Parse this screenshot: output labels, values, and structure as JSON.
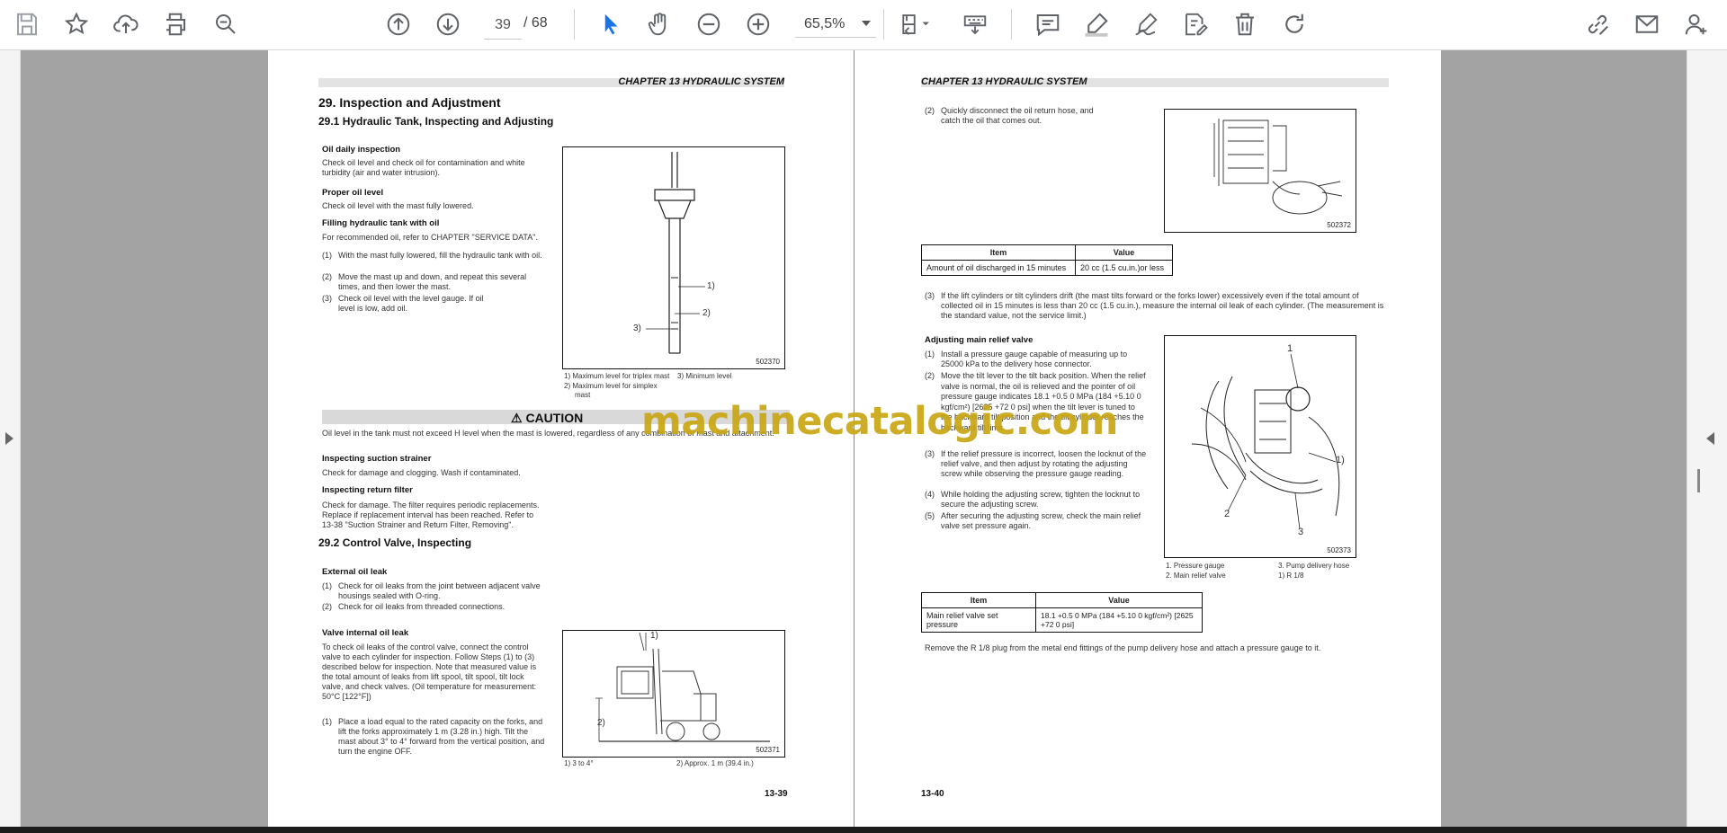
{
  "toolbar": {
    "page_current": "39",
    "page_total": "/ 68",
    "zoom": "65,5%",
    "icons": [
      "save-icon",
      "star-icon",
      "upload-icon",
      "print-icon",
      "zoom-search-icon",
      "page-up-icon",
      "page-down-icon",
      "select-arrow-icon",
      "hand-icon",
      "zoom-out-icon",
      "zoom-in-icon",
      "fit-page-icon",
      "keyboard-icon",
      "comment-icon",
      "highlight-pen-icon",
      "sign-pen-icon",
      "edit-doc-icon",
      "trash-icon",
      "redo-icon",
      "share-link-icon",
      "mail-icon",
      "add-user-icon"
    ]
  },
  "left_page": {
    "chapter": "CHAPTER 13 HYDRAULIC SYSTEM",
    "title": "29.  Inspection and Adjustment",
    "section1": "29.1    Hydraulic Tank, Inspecting and Adjusting",
    "oil_daily_heading": "Oil daily inspection",
    "oil_daily_text": "Check oil level and check oil for contamination and white turbidity (air and water intrusion).",
    "proper_heading": "Proper oil level",
    "proper_text": "Check oil level with the mast fully lowered.",
    "filling_heading": "Filling hydraulic tank with oil",
    "filling_text": "For recommended oil, refer to CHAPTER \"SERVICE DATA\".",
    "fill_steps": [
      {
        "n": "(1)",
        "text": "With the mast fully lowered, fill the hydraulic tank with oil."
      },
      {
        "n": "(2)",
        "text": "Move the mast up and down, and repeat this several times, and then lower the mast."
      },
      {
        "n": "(3)",
        "text": "Check oil level with the level gauge. If oil level is low, add oil."
      }
    ],
    "fig1_labels": [
      "1)",
      "2)",
      "3)"
    ],
    "fig1_no": "502370",
    "fig1_caption_a": "1) Maximum level for triplex mast",
    "fig1_caption_b": "3) Minimum level",
    "fig1_caption_c": "2) Maximum level for simplex",
    "fig1_caption_d": "mast",
    "caution_title": "⚠ CAUTION",
    "caution_text": "Oil level in the tank must not exceed H level when the mast is lowered, regardless of any combination of mast and attachment.",
    "suction_heading": "Inspecting suction strainer",
    "suction_text": "Check for damage and clogging. Wash if contaminated.",
    "return_heading": "Inspecting return filter",
    "return_text": "Check for damage. The filter requires periodic replacements. Replace if replacement interval has been reached. Refer to 13-38 \"Suction Strainer and Return Filter, Removing\".",
    "section2": "29.2    Control Valve, Inspecting",
    "ext_heading": "External oil leak",
    "ext_steps": [
      {
        "n": "(1)",
        "text": "Check for oil leaks from the joint between adjacent valve housings sealed with O-ring."
      },
      {
        "n": "(2)",
        "text": "Check for oil leaks from threaded connections."
      }
    ],
    "int_heading": "Valve internal oil leak",
    "int_text": "To check oil leaks of the control valve, connect the control valve to each cylinder for inspection. Follow Steps (1) to (3) described below for inspection. Note that measured value is the total amount of leaks from lift spool, tilt spool, tilt lock valve, and check valves. (Oil temperature for measurement: 50°C [122°F])",
    "int_step1_n": "(1)",
    "int_step1": "Place a load equal to the rated capacity on the forks, and lift the forks approximately 1 m (3.28 in.) high. Tilt the mast about 3° to 4° forward from the vertical position, and turn the engine OFF.",
    "fig2_labels": [
      "1)",
      "2)"
    ],
    "fig2_no": "502371",
    "fig2_caption_a": "1) 3 to 4°",
    "fig2_caption_b": "2) Approx. 1 m (39.4 in.)",
    "page_number": "13-39"
  },
  "right_page": {
    "chapter": "CHAPTER 13 HYDRAULIC SYSTEM",
    "step2_n": "(2)",
    "step2": "Quickly disconnect the oil return hose, and catch the oil that comes out.",
    "fig3_no": "502372",
    "table1": {
      "headers": [
        "Item",
        "Value"
      ],
      "rows": [
        [
          "Amount of oil discharged in 15 minutes",
          "20 cc (1.5 cu.in.)or less"
        ]
      ]
    },
    "step3_n": "(3)",
    "step3": "If the lift cylinders or tilt cylinders drift (the mast tilts forward or the forks lower) excessively even if the total amount of collected oil in 15 minutes is less than 20 cc (1.5 cu.in.), measure the internal oil leak of each cylinder. (The measurement is the standard value, not the service limit.)",
    "relief_heading": "Adjusting main relief valve",
    "relief_steps": [
      {
        "n": "(1)",
        "text": "Install a pressure gauge capable of measuring up to 25000 kPa to the delivery hose connector."
      },
      {
        "n": "(2)",
        "text": "Move the tilt lever to the tilt back position. When the relief valve is normal, the oil is relieved and the pointer of oil pressure gauge indicates 18.1 +0.5 0 MPa (184 +5.10 0 kgf/cm²) [2625 +72 0 psi] when the tilt lever is tuned to the backward tilt position and the tilt cylinder reaches the backward tilt limit."
      },
      {
        "n": "(3)",
        "text": "If the relief pressure is incorrect, loosen the locknut of the relief valve, and then adjust by rotating the adjusting screw while observing the pressure gauge reading."
      },
      {
        "n": "(4)",
        "text": "While holding the adjusting screw, tighten the locknut to secure the adjusting screw."
      },
      {
        "n": "(5)",
        "text": "After securing the adjusting screw, check the main relief valve set pressure again."
      }
    ],
    "fig4_labels": [
      "1",
      "1)",
      "2",
      "3"
    ],
    "fig4_no": "502373",
    "fig4_caption_a": "1. Pressure gauge",
    "fig4_caption_b": "3. Pump delivery hose",
    "fig4_caption_c": "2. Main relief valve",
    "fig4_caption_d": "1) R 1/8",
    "table2": {
      "headers": [
        "Item",
        "Value"
      ],
      "rows": [
        [
          "Main relief valve set pressure",
          "18.1 +0.5 0 MPa (184 +5.10 0 kgf/cm²) [2625 +72 0 psi]"
        ]
      ]
    },
    "remove_text": "Remove the R 1/8 plug from the metal end fittings of the pump delivery hose and attach a pressure gauge to it.",
    "page_number": "13-40"
  },
  "watermark": "machinecatalogic.com",
  "colors": {
    "toolbar_icon": "#5f6368",
    "select_icon": "#1a73e8",
    "viewer_gray": "#a3a3a3",
    "watermark": "#c9a614"
  }
}
